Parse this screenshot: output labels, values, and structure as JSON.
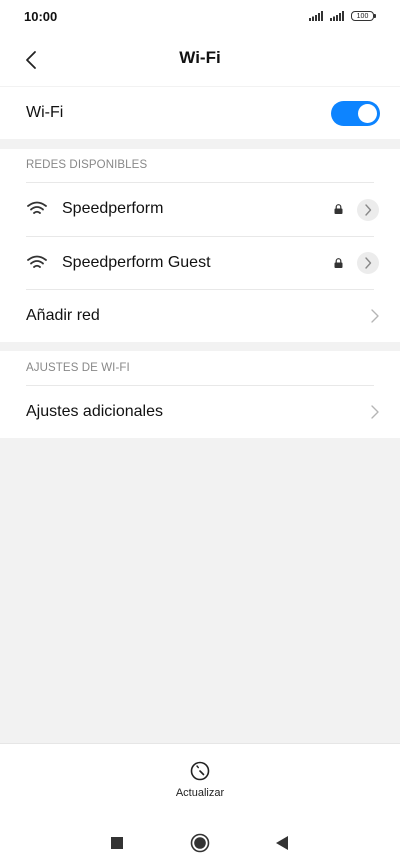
{
  "status_bar": {
    "time": "10:00",
    "battery": "100"
  },
  "header": {
    "title": "Wi-Fi",
    "back_icon": "chevron-left-icon"
  },
  "wifi_toggle": {
    "label": "Wi-Fi",
    "enabled": true,
    "accent_color": "#0d84ff"
  },
  "available_networks": {
    "section_label": "REDES DISPONIBLES",
    "networks": [
      {
        "name": "Speedperform",
        "secured": true
      },
      {
        "name": "Speedperform Guest",
        "secured": true
      }
    ],
    "add_network_label": "Añadir red"
  },
  "wifi_settings": {
    "section_label": "AJUSTES DE WI-FI",
    "additional_label": "Ajustes adicionales"
  },
  "bottom_action": {
    "label": "Actualizar",
    "icon": "refresh-icon"
  },
  "nav_bar": {
    "icons": [
      "recents-square-icon",
      "home-circle-icon",
      "back-triangle-icon"
    ]
  }
}
